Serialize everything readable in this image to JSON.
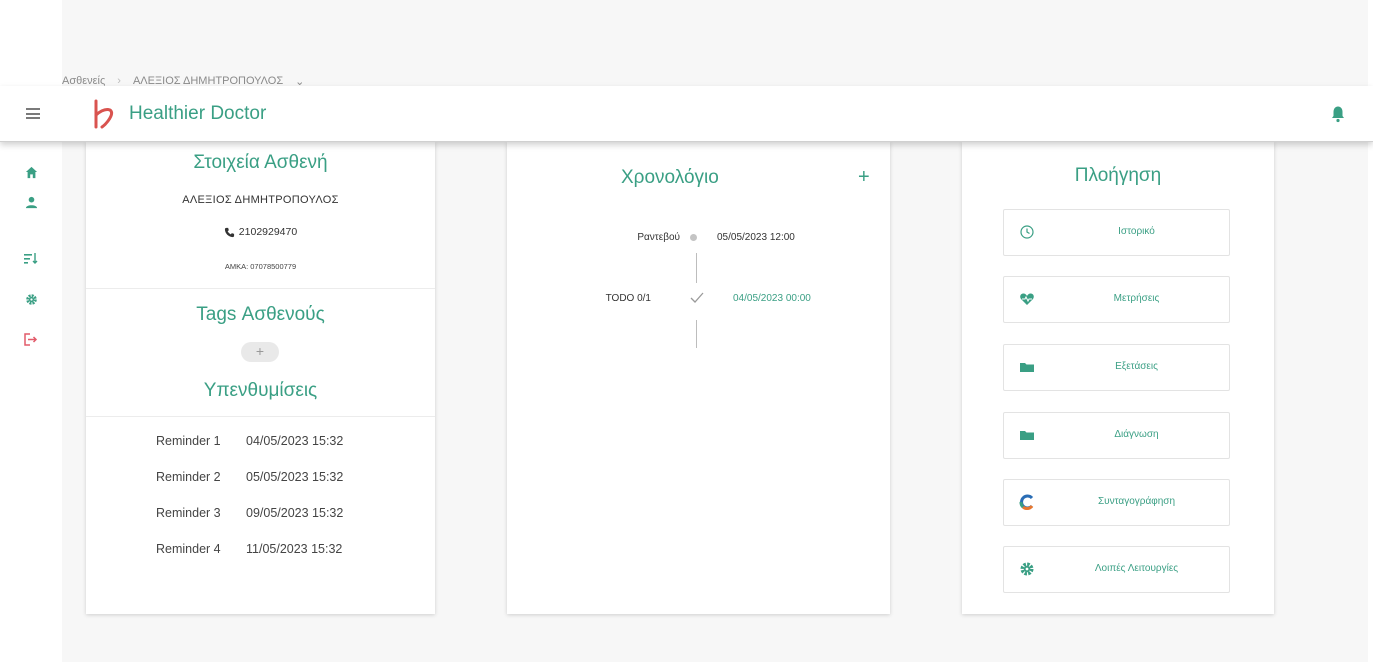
{
  "app": {
    "brand": "Healthier Doctor",
    "accent": "#3a9f84",
    "logo_color": "#d9534f"
  },
  "breadcrumb": {
    "root": "Ασθενείς",
    "current": "ΑΛΕΞΙΟΣ ΔΗΜΗΤΡΟΠΟΥΛΟΣ",
    "dropdown": "⌄"
  },
  "sidebar": {
    "items": [
      {
        "icon": "home-icon"
      },
      {
        "icon": "person-icon"
      },
      {
        "icon": "sort-list-icon"
      },
      {
        "icon": "settings-icon"
      },
      {
        "icon": "logout-icon"
      }
    ]
  },
  "patient": {
    "title": "Στοιχεία Ασθενή",
    "name": "ΑΛΕΞΙΟΣ ΔΗΜΗΤΡΟΠΟΥΛΟΣ",
    "phone": "2102929470",
    "amka": "AMKA: 07078500779"
  },
  "tags": {
    "title": "Tags Ασθενούς",
    "add": "+"
  },
  "reminders": {
    "title": "Υπενθυμίσεις",
    "items": [
      {
        "label": "Reminder 1",
        "date": "04/05/2023 15:32"
      },
      {
        "label": "Reminder 2",
        "date": "05/05/2023 15:32"
      },
      {
        "label": "Reminder 3",
        "date": "09/05/2023 15:32"
      },
      {
        "label": "Reminder 4",
        "date": "11/05/2023 15:32"
      }
    ]
  },
  "timeline": {
    "title": "Χρονολόγιο",
    "add": "+",
    "events": [
      {
        "label": "Ραντεβού",
        "date": "05/05/2023 12:00",
        "color": "#333333"
      },
      {
        "label": "TODO 0/1",
        "date": "04/05/2023 00:00",
        "color": "#3a9f84"
      }
    ]
  },
  "navigation": {
    "title": "Πλοήγηση",
    "buttons": [
      {
        "label": "Ιστορικό",
        "icon": "history-icon"
      },
      {
        "label": "Μετρήσεις",
        "icon": "heart-pulse-icon"
      },
      {
        "label": "Εξετάσεις",
        "icon": "folder-icon"
      },
      {
        "label": "Διάγνωση",
        "icon": "folder-icon"
      },
      {
        "label": "Συνταγογράφηση",
        "icon": "prescription-logo-icon"
      },
      {
        "label": "Λοιπές Λειτουργίες",
        "icon": "gear-icon"
      }
    ]
  }
}
